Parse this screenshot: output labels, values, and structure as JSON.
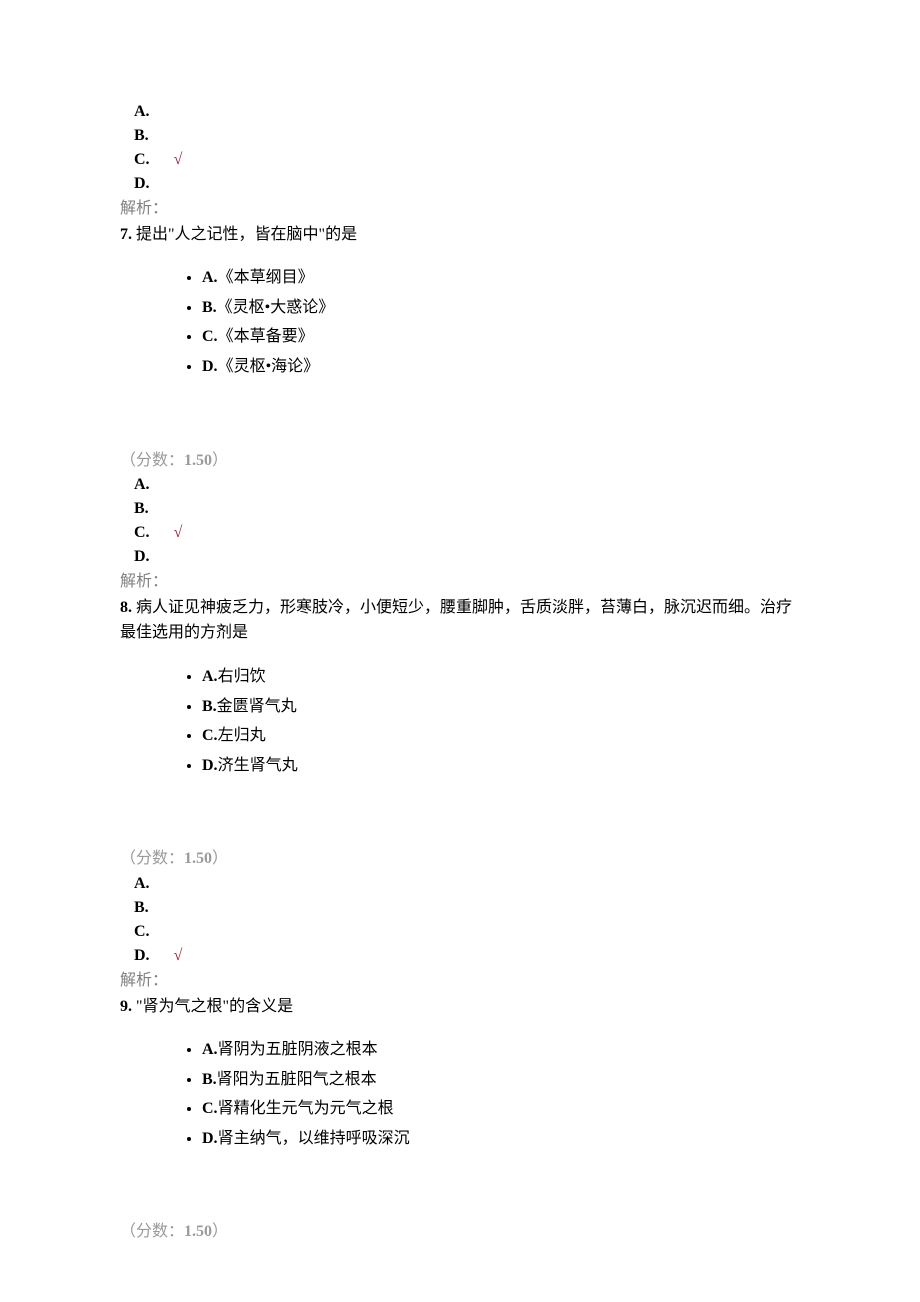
{
  "labels": {
    "jiexi": "解析：",
    "score_prefix": "（分数：",
    "score_suffix": "）",
    "mark": "√"
  },
  "q6_tail": {
    "answers": [
      "A.",
      "B.",
      "C.",
      "D."
    ],
    "correct_index": 2
  },
  "q7": {
    "num": "7.",
    "text": " 提出\"人之记性，皆在脑中\"的是",
    "options": [
      {
        "letter": "A.",
        "text": "《本草纲目》"
      },
      {
        "letter": "B.",
        "text": "《灵枢•大惑论》"
      },
      {
        "letter": "C.",
        "text": "《本草备要》"
      },
      {
        "letter": "D.",
        "text": "《灵枢•海论》"
      }
    ],
    "score": "1.50",
    "answers": [
      "A.",
      "B.",
      "C.",
      "D."
    ],
    "correct_index": 2
  },
  "q8": {
    "num": "8.",
    "text": " 病人证见神疲乏力，形寒肢冷，小便短少，腰重脚肿，舌质淡胖，苔薄白，脉沉迟而细。治疗最佳选用的方剂是",
    "options": [
      {
        "letter": "A.",
        "text": "右归饮"
      },
      {
        "letter": "B.",
        "text": "金匮肾气丸"
      },
      {
        "letter": "C.",
        "text": "左归丸"
      },
      {
        "letter": "D.",
        "text": "济生肾气丸"
      }
    ],
    "score": "1.50",
    "answers": [
      "A.",
      "B.",
      "C.",
      "D."
    ],
    "correct_index": 3
  },
  "q9": {
    "num": "9.",
    "text": " \"肾为气之根\"的含义是",
    "options": [
      {
        "letter": "A.",
        "text": "肾阴为五脏阴液之根本"
      },
      {
        "letter": "B.",
        "text": "肾阳为五脏阳气之根本"
      },
      {
        "letter": "C.",
        "text": "肾精化生元气为元气之根"
      },
      {
        "letter": "D.",
        "text": "肾主纳气，以维持呼吸深沉"
      }
    ],
    "score": "1.50"
  }
}
